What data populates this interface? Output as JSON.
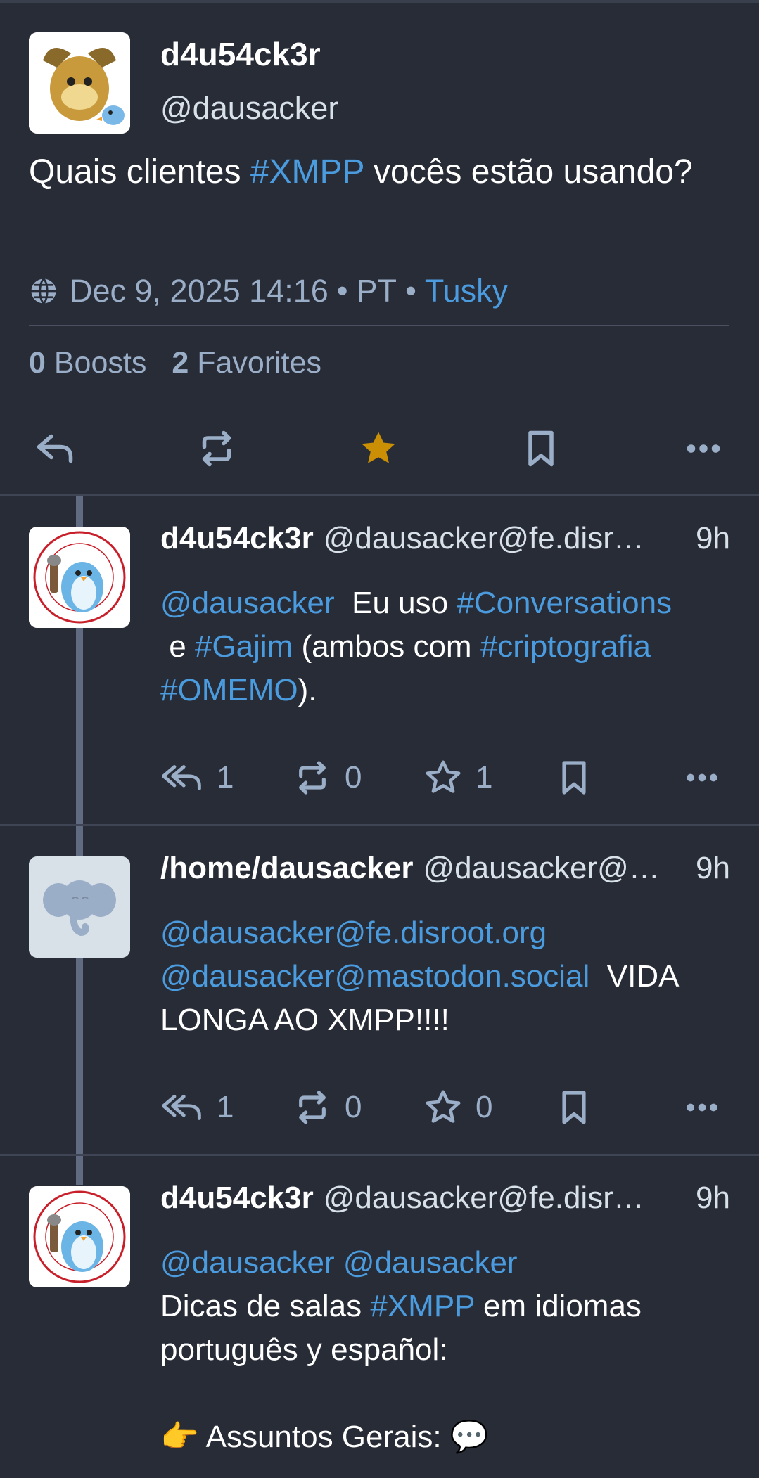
{
  "main_status": {
    "display_name": "d4u54ck3r",
    "username": "@dausacker",
    "content": {
      "before": "Quais clientes ",
      "tag": "#XMPP",
      "after": " vocês estão usando?"
    },
    "date": "Dec 9, 2025 14:16",
    "separator": "•",
    "language": "PT",
    "client": "Tusky",
    "boosts_count": "0",
    "boosts_label": "Boosts",
    "favorites_count": "2",
    "favorites_label": "Favorites",
    "favorited": true
  },
  "replies": [
    {
      "display_name": "d4u54ck3r",
      "username": "@dausacker@fe.disr…",
      "time": "9h",
      "content": {
        "mention": "@dausacker",
        "t1": "  Eu uso ",
        "tag1": "#Conversations",
        "t2": " e ",
        "tag2": "#Gajim",
        "t3": " (ambos com ",
        "tag3": "#criptografia",
        "t4": " ",
        "tag4": "#OMEMO",
        "t5": ")."
      },
      "replies_count": "1",
      "boosts_count": "0",
      "favorites_count": "1"
    },
    {
      "display_name": "/home/dausacker",
      "username": "@dausacker@…",
      "time": "9h",
      "content": {
        "mention1": "@dausacker@fe.disroot.org",
        "mention2": "@dausacker@mastodon.social",
        "text": "  VIDA LONGA AO XMPP!!!!"
      },
      "replies_count": "1",
      "boosts_count": "0",
      "favorites_count": "0"
    },
    {
      "display_name": "d4u54ck3r",
      "username": "@dausacker@fe.disr…",
      "time": "9h",
      "content": {
        "mention1": "@dausacker",
        "mention2": "@dausacker",
        "t1": "Dicas de salas ",
        "tag1": "#XMPP",
        "t2": " em idiomas português y español:",
        "bullet_emoji": "👉",
        "bullet_text": " Assuntos Gerais: ",
        "bubble_emoji": "💬"
      }
    }
  ],
  "colors": {
    "background": "#282c37",
    "link": "#4b9bdf",
    "muted": "#9baec8",
    "favorite": "#ca8f04"
  },
  "icons": [
    "globe-icon",
    "reply-icon",
    "reply-all-icon",
    "boost-icon",
    "star-icon",
    "bookmark-icon",
    "more-icon"
  ]
}
